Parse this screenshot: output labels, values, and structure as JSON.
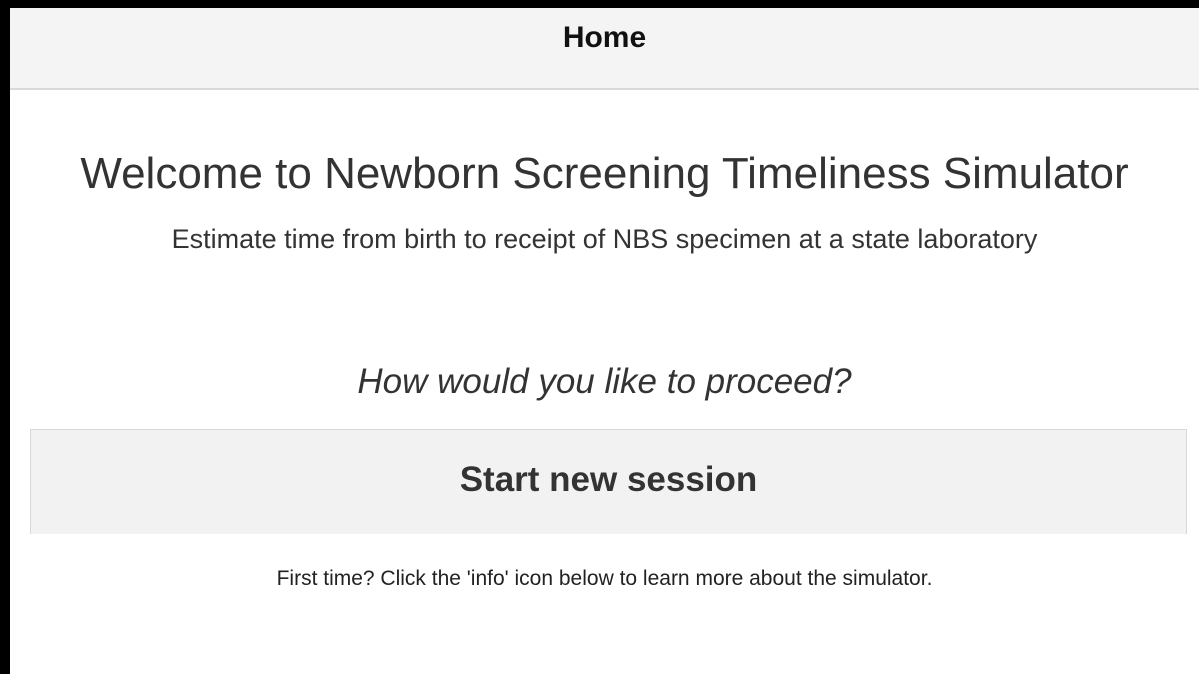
{
  "header": {
    "title": "Home"
  },
  "main": {
    "welcome_title": "Welcome to Newborn Screening Timeliness Simulator",
    "subtitle": "Estimate time from birth to receipt of NBS specimen at a state laboratory",
    "prompt": "How would you like to proceed?",
    "start_button_label": "Start new session",
    "hint": "First time? Click the 'info' icon below to learn more about the simulator."
  },
  "colors": {
    "header_background": "#f4f4f4",
    "button_background": "#f2f2f2",
    "text": "#333333",
    "frame": "#000000"
  }
}
